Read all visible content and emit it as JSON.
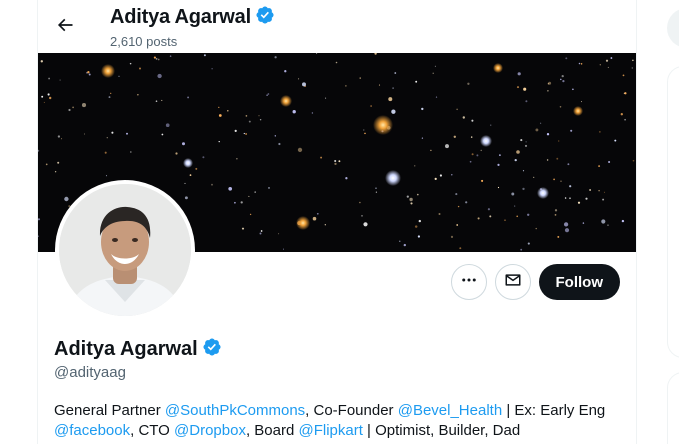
{
  "header": {
    "back_icon": "arrow-left-icon",
    "display_name": "Aditya Agarwal",
    "post_count": "2,610 posts"
  },
  "profile": {
    "display_name": "Aditya Agarwal",
    "handle": "@adityaag",
    "verified_icon": "verified-badge-icon",
    "bio": [
      {
        "text": "General Partner ",
        "type": "text"
      },
      {
        "text": "@SouthPkCommons",
        "type": "mention"
      },
      {
        "text": ", Co-Founder ",
        "type": "text"
      },
      {
        "text": "@Bevel_Health",
        "type": "mention"
      },
      {
        "text": " | Ex: Early Eng ",
        "type": "text"
      },
      {
        "text": "@facebook",
        "type": "mention"
      },
      {
        "text": ", CTO ",
        "type": "text"
      },
      {
        "text": "@Dropbox",
        "type": "mention"
      },
      {
        "text": ", Board ",
        "type": "text"
      },
      {
        "text": "@Flipkart",
        "type": "mention"
      },
      {
        "text": " | Optimist, Builder, Dad",
        "type": "text"
      }
    ]
  },
  "actions": {
    "more_icon": "more-horizontal-icon",
    "message_icon": "envelope-icon",
    "follow_label": "Follow"
  },
  "colors": {
    "accent": "#1d9bf0",
    "text_primary": "#0f1419",
    "text_secondary": "#536471",
    "follow_bg": "#0f1419",
    "border": "#cfd9de"
  }
}
